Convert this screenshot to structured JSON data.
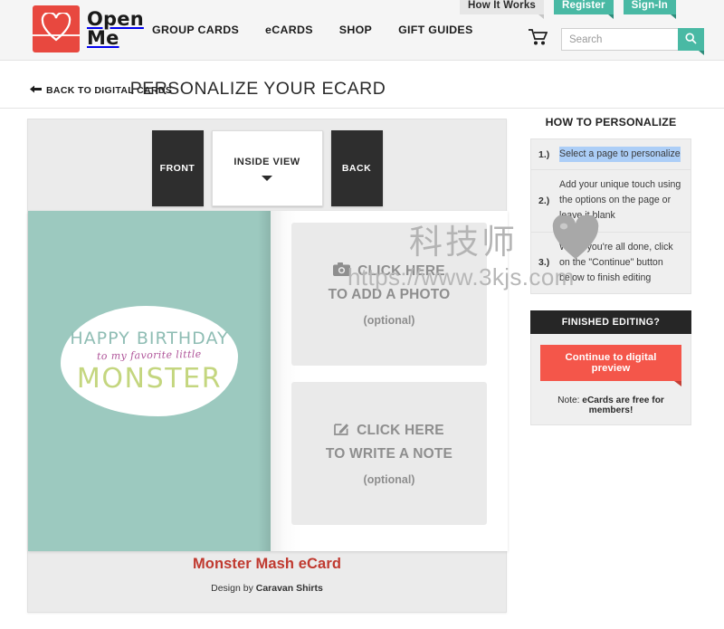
{
  "header": {
    "brand": {
      "line1": "Open",
      "line2": "Me",
      "icon": "heart-logo-icon",
      "color": "#e8483f"
    },
    "nav": [
      {
        "label": "GROUP CARDS"
      },
      {
        "label": "eCARDS"
      },
      {
        "label": "SHOP"
      },
      {
        "label": "GIFT GUIDES"
      }
    ],
    "how_it_works": "How It Works",
    "register": "Register",
    "signin": "Sign-In",
    "cart_icon": "shopping-cart-icon",
    "search": {
      "placeholder": "Search",
      "value": "",
      "icon": "search-icon"
    },
    "accent_teal": "#49b9a4"
  },
  "titlebar": {
    "back_label": "BACK TO DIGITAL CARDS",
    "back_icon": "arrow-left-icon",
    "page_title": "PERSONALIZE YOUR ECARD"
  },
  "editor": {
    "tabs": [
      {
        "label": "FRONT",
        "selected": false
      },
      {
        "label": "INSIDE VIEW",
        "selected": true,
        "icon": "chevron-down-icon"
      },
      {
        "label": "BACK",
        "selected": false
      }
    ],
    "card_front": {
      "background": "#9cc9bf",
      "line1": "HAPPY BIRTHDAY",
      "line1_color": "#8fbdb4",
      "line2": "to my favorite little",
      "line2_color": "#b0559a",
      "line3": "MONSTER",
      "line3_color": "#c4d67f"
    },
    "photo_zone": {
      "icon": "camera-icon",
      "line1": "CLICK HERE",
      "line2": "TO ADD A PHOTO",
      "optional": "(optional)"
    },
    "note_zone": {
      "icon": "pencil-edit-icon",
      "line1": "CLICK HERE",
      "line2": "TO WRITE A NOTE",
      "optional": "(optional)"
    },
    "caption": {
      "title": "Monster Mash eCard",
      "title_color": "#c0392f",
      "design_by_prefix": "Design by ",
      "designer": "Caravan Shirts"
    }
  },
  "sidebar": {
    "title": "HOW TO PERSONALIZE",
    "steps": [
      {
        "num": "1.)",
        "text": "Select a page to personalize",
        "selected": true
      },
      {
        "num": "2.)",
        "text": "Add your unique touch using the options on the page or leave it blank",
        "selected": false
      },
      {
        "num": "3.)",
        "text": "When you're all done, click on the \"Continue\" button below to finish editing",
        "selected": false
      }
    ],
    "finished": {
      "heading": "FINISHED EDITING?",
      "cta_label": "Continue to digital preview",
      "cta_color": "#f4564a",
      "note_prefix": "Note: ",
      "note_bold": "eCards are free for members!"
    }
  },
  "watermark": {
    "cn_text": "科技师",
    "url_text": "https://www.3kjs.com",
    "heart_icon": "heart-watermark-icon"
  }
}
